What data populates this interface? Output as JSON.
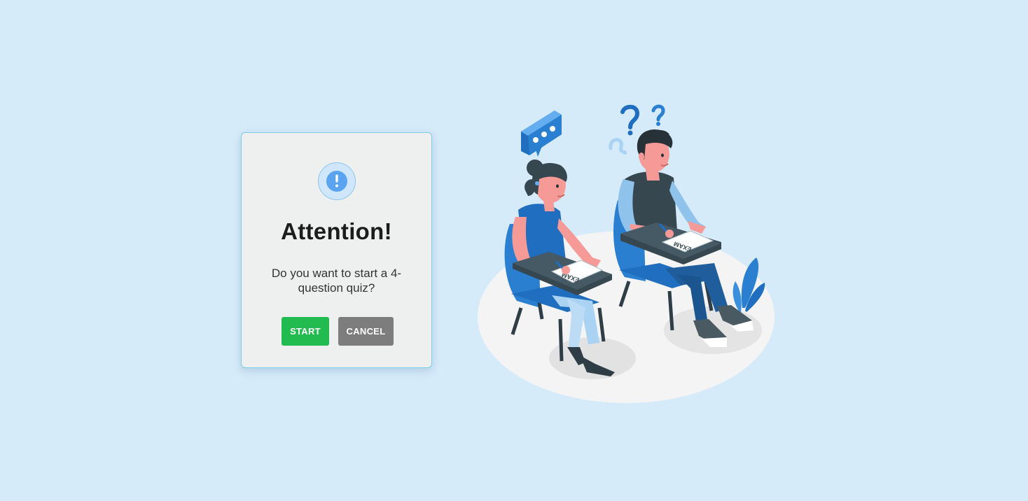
{
  "page": {
    "background_color": "#d5ebfa"
  },
  "dialog": {
    "icon": "exclamation-circle-icon",
    "title": "Attention!",
    "message": "Do you want to start a 4-question quiz?",
    "start_label": "START",
    "cancel_label": "CANCEL",
    "start_color": "#22bb4f",
    "cancel_color": "#7d7d7d",
    "icon_color": "#5aa3f0"
  },
  "illustration": {
    "description_icon": "students-taking-exam-illustration",
    "paper_label_1": "EXAM",
    "paper_label_2": "EXAM"
  }
}
